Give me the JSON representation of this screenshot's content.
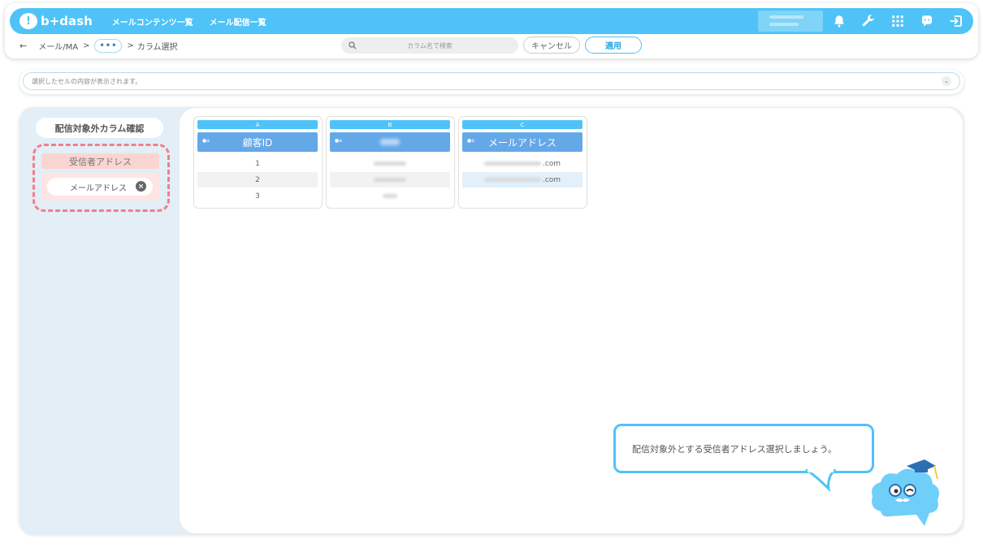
{
  "header": {
    "logo_text": "b+dash",
    "nav": [
      "メールコンテンツ一覧",
      "メール配信一覧"
    ]
  },
  "toolbar": {
    "back": "←",
    "breadcrumb_root": "メール/MA",
    "sep1": ">",
    "dots": "•••",
    "sep2": ">",
    "current": "カラム選択",
    "search_placeholder": "カラム名で検索",
    "cancel_label": "キャンセル",
    "apply_label": "適用"
  },
  "cellbar": {
    "placeholder": "選択したセルの内容が表示されます。"
  },
  "sidebar": {
    "title": "配信対象外カラム確認",
    "group_label": "受信者アドレス",
    "chip_label": "メールアドレス",
    "chip_remove": "×"
  },
  "columns": [
    {
      "letter": "A",
      "header": "顧客ID",
      "type": "a",
      "rows": [
        "1",
        "2",
        "3"
      ]
    },
    {
      "letter": "B",
      "header": "",
      "type": "a",
      "rows": [
        "",
        "",
        ""
      ]
    },
    {
      "letter": "C",
      "header": "メールアドレス",
      "type": "a",
      "rows": [
        ".com",
        ".com"
      ]
    }
  ],
  "assistant": {
    "message": "配信対象外とする受信者アドレス選択しましょう。"
  },
  "colors": {
    "brand": "#4fc3f7",
    "header_cell": "#64a8e8",
    "highlight": "#f07f8a"
  }
}
